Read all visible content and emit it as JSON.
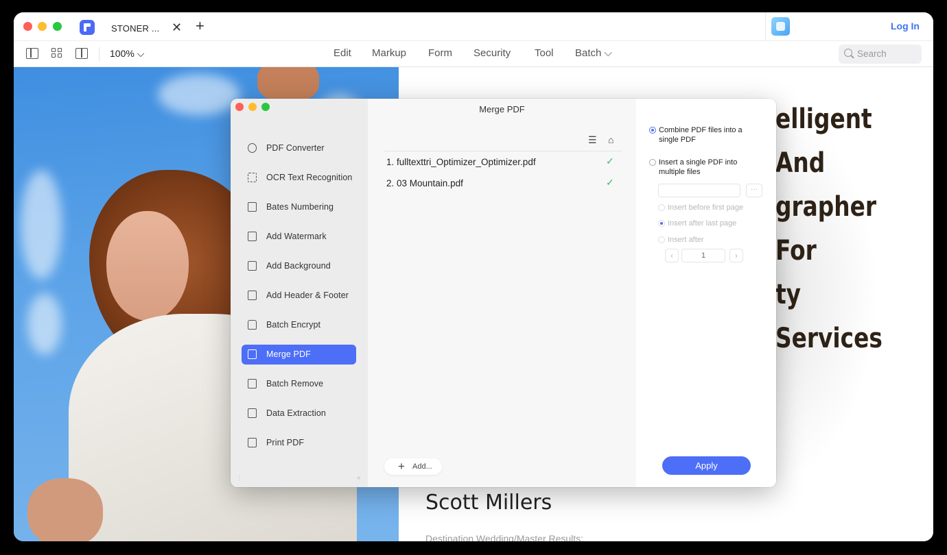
{
  "tab": {
    "title": "STONER ...",
    "close_glyph": "✕",
    "new_glyph": "+"
  },
  "header": {
    "login_label": "Log In"
  },
  "toolbar": {
    "zoom": "100% ⌵",
    "menus": [
      "Edit",
      "Markup",
      "Form",
      "Security",
      "Tool",
      "Batch ⌵"
    ],
    "search_placeholder": "Search"
  },
  "document": {
    "headline_lines": [
      "elligent And",
      "grapher For",
      "ty Services"
    ],
    "person_name": "Scott Millers",
    "person_subtitle": "Destination Wedding/Master Results:"
  },
  "dialog": {
    "title": "Merge PDF",
    "sidebar": [
      {
        "label": "PDF Converter",
        "icon": "convert-icon"
      },
      {
        "label": "OCR Text Recognition",
        "icon": "ocr-icon"
      },
      {
        "label": "Bates Numbering",
        "icon": "bates-icon"
      },
      {
        "label": "Add Watermark",
        "icon": "watermark-icon"
      },
      {
        "label": "Add Background",
        "icon": "background-icon"
      },
      {
        "label": "Add Header & Footer",
        "icon": "header-footer-icon"
      },
      {
        "label": "Batch Encrypt",
        "icon": "lock-icon"
      },
      {
        "label": "Merge PDF",
        "icon": "merge-icon",
        "active": true
      },
      {
        "label": "Batch Remove",
        "icon": "trash-icon"
      },
      {
        "label": "Data Extraction",
        "icon": "export-icon"
      },
      {
        "label": "Print PDF",
        "icon": "printer-icon"
      }
    ],
    "list_tools": {
      "menu_glyph": "☰",
      "clear_glyph": "⌂"
    },
    "files": [
      {
        "name": "1.  fulltexttri_Optimizer_Optimizer.pdf",
        "status": "✓"
      },
      {
        "name": "2.  03 Mountain.pdf",
        "status": "✓"
      }
    ],
    "add_label": "Add...",
    "options": {
      "combine_label": "Combine PDF files into a single PDF",
      "insert_label": "Insert a single PDF into multiple files",
      "browse_glyph": "···",
      "before_first": "Insert before first page",
      "after_last": "Insert after last page",
      "insert_after": "Insert after",
      "page_value": "1",
      "prev_glyph": "‹",
      "next_glyph": "›"
    },
    "apply_label": "Apply"
  },
  "colors": {
    "accent": "#4d6ef7",
    "link": "#3f73f0",
    "check": "#3bba6a"
  }
}
